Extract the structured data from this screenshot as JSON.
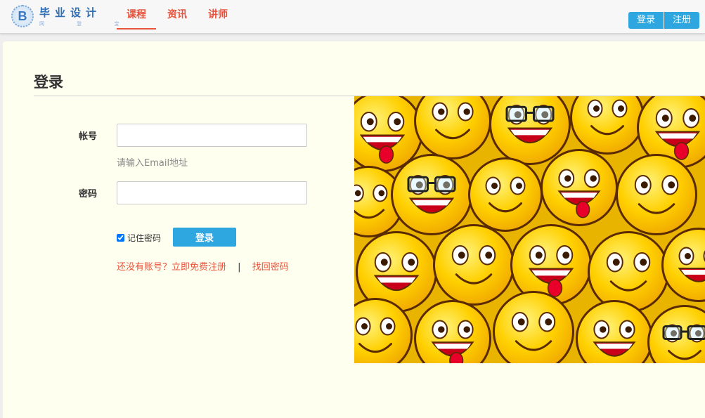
{
  "brand": {
    "badge_letter": "B",
    "title": "毕业设计",
    "subtitle": "网 登 宝"
  },
  "nav": {
    "items": [
      {
        "label": "课程",
        "active": true
      },
      {
        "label": "资讯",
        "active": false
      },
      {
        "label": "讲师",
        "active": false
      }
    ]
  },
  "auth": {
    "login_label": "登录",
    "register_label": "注册"
  },
  "login": {
    "page_title": "登录",
    "account_label": "帐号",
    "account_value": "",
    "account_hint": "请输入Email地址",
    "password_label": "密码",
    "password_value": "",
    "remember_label": "记住密码",
    "remember_checked": true,
    "submit_label": "登录",
    "register_link": "还没有账号？立即免费注册",
    "separator": "|",
    "forgot_link": "找回密码"
  },
  "colors": {
    "accent_blue": "#2ea6e0",
    "nav_red": "#e8533c",
    "panel_bg": "#fffff0"
  },
  "hero_image": {
    "icon": "smiley-faces-image"
  }
}
